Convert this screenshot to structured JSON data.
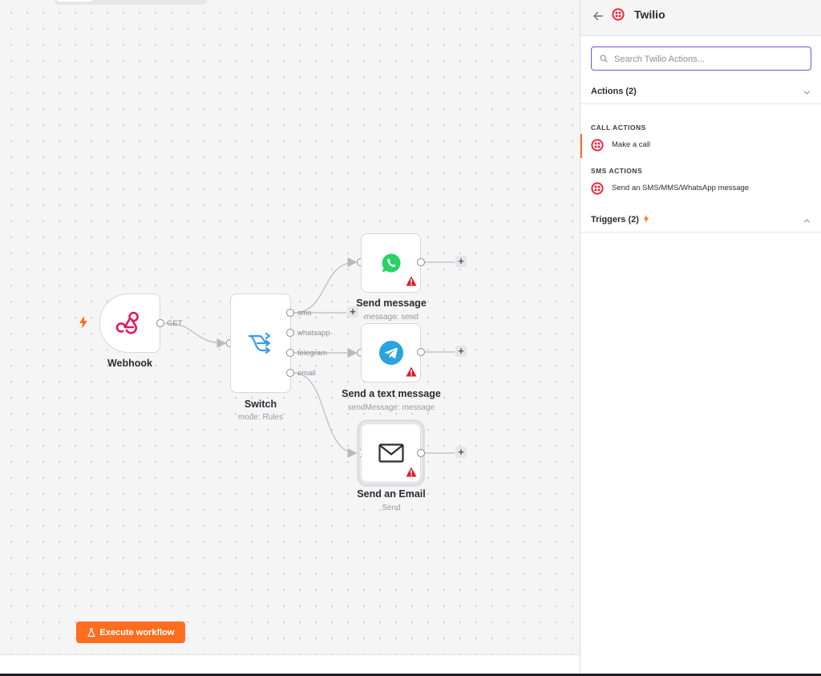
{
  "canvas": {
    "nodes": {
      "webhook": {
        "title": "Webhook",
        "port_label": "GET"
      },
      "switch": {
        "title": "Switch",
        "subtitle": "mode: Rules",
        "outputs": [
          "sms",
          "whatsapp",
          "telegram",
          "email"
        ]
      },
      "whatsapp": {
        "title": "Send message",
        "subtitle": "message: send"
      },
      "telegram": {
        "title": "Send a text message",
        "subtitle": "sendMessage: message"
      },
      "email": {
        "title": "Send an Email",
        "subtitle": "Send"
      }
    },
    "plus_label": "+",
    "execute_button": {
      "label": "Execute workflow"
    }
  },
  "panel": {
    "title": "Twilio",
    "search": {
      "placeholder": "Search Twilio Actions...",
      "value": ""
    },
    "actions_section": {
      "label": "Actions (2)"
    },
    "groups": [
      {
        "label": "CALL ACTIONS",
        "items": [
          {
            "label": "Make a call"
          }
        ]
      },
      {
        "label": "SMS ACTIONS",
        "items": [
          {
            "label": "Send an SMS/MMS/WhatsApp message"
          }
        ]
      }
    ],
    "triggers_section": {
      "label": "Triggers (2)"
    }
  },
  "colors": {
    "accent": "#ff6d1f",
    "twilio": "#e8283f",
    "search_focus": "#7b4fd6",
    "whatsapp": "#25d366",
    "telegram": "#2aa3df",
    "webhook": "#e5195f",
    "switch": "#3b9ce4",
    "warning": "#e01b24"
  }
}
